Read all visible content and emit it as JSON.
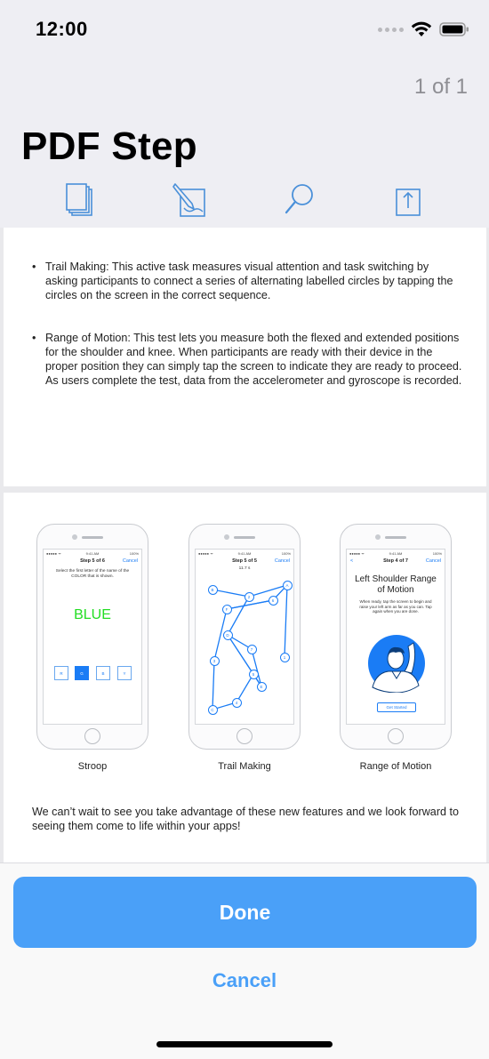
{
  "status_bar": {
    "time": "12:00"
  },
  "header": {
    "page_counter": "1 of 1",
    "title": "PDF Step"
  },
  "toolbar": {
    "items": [
      {
        "icon": "thumbnails-icon"
      },
      {
        "icon": "annotate-icon"
      },
      {
        "icon": "search-icon"
      },
      {
        "icon": "share-icon"
      }
    ],
    "accent_color": "#4a90d9"
  },
  "document": {
    "bullets": [
      {
        "marker": "•",
        "text": "Trail Making:  This active task measures visual attention and task switching by asking participants to connect a series of alternating labelled circles by tapping the circles on the screen in the correct sequence."
      },
      {
        "marker": "•",
        "text": "Range of Motion: This test lets you measure both the flexed and extended positions for the shoulder and knee.  When participants are ready with their device in the proper position they can simply tap the screen to indicate they are ready to proceed.  As users complete the test, data from the accelerometer and gyroscope is recorded."
      }
    ],
    "phones": {
      "stroop": {
        "status_left": "●●●●● ᯤ",
        "status_time": "9:41 AM",
        "status_right": "100%",
        "nav_title": "Step 5 of 6",
        "nav_right": "Cancel",
        "instruction": "Select the first letter of the name of the COLOR that is shown.",
        "word": "BLUE",
        "word_color": "#22dd22",
        "options": [
          "R",
          "G",
          "B",
          "Y"
        ],
        "caption": "Stroop"
      },
      "trail": {
        "status_left": "●●●●● ᯤ",
        "status_time": "9:41 AM",
        "status_right": "100%",
        "nav_title": "Step 5 of 5",
        "nav_right": "Cancel",
        "timer": "11.7 s",
        "nodes": [
          "B",
          "2",
          "A",
          "F",
          "6",
          "D",
          "7",
          "3",
          "1",
          "5",
          "E",
          "4",
          "C"
        ],
        "caption": "Trail Making"
      },
      "motion": {
        "status_left": "●●●●● ᯤ",
        "status_time": "9:41 AM",
        "status_right": "100%",
        "nav_left": "<",
        "nav_title": "Step 4 of 7",
        "nav_right": "Cancel",
        "heading": "Left Shoulder Range of Motion",
        "instruction": "When ready, tap the screen to begin and raise your left arm as far as you can. Tap again when you are done.",
        "button": "Get Started",
        "caption": "Range of Motion"
      }
    },
    "closing": "We can’t wait to see you take advantage of these new features and we look forward to seeing them come to life within your apps!"
  },
  "actions": {
    "done_label": "Done",
    "cancel_label": "Cancel",
    "primary_color": "#4aa0f8"
  }
}
